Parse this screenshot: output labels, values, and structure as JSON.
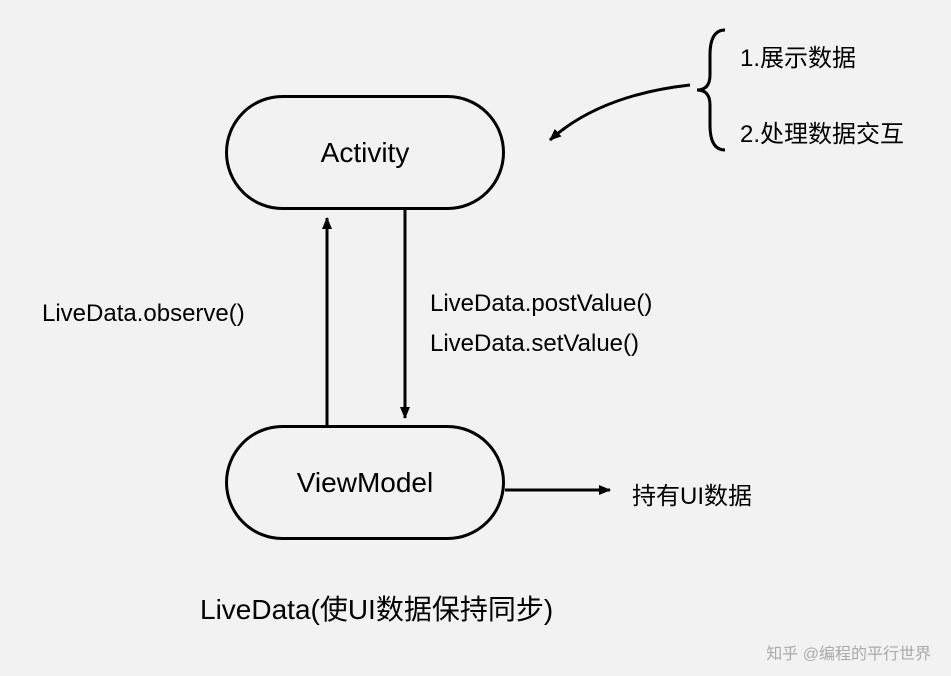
{
  "nodes": {
    "activity": "Activity",
    "viewmodel": "ViewModel"
  },
  "edges": {
    "observe": "LiveData.observe()",
    "postValue": "LiveData.postValue()",
    "setValue": "LiveData.setValue()",
    "holdsUIData": "持有UI数据"
  },
  "responsibilities": {
    "item1": "1.展示数据",
    "item2": "2.处理数据交互"
  },
  "caption": "LiveData(使UI数据保持同步)",
  "watermark": "知乎 @编程的平行世界"
}
